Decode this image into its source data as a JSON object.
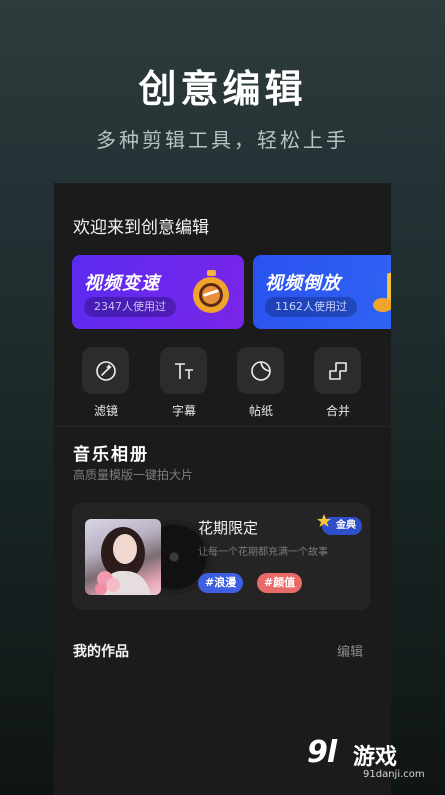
{
  "hero": {
    "title": "创意编辑",
    "subtitle": "多种剪辑工具，轻松上手"
  },
  "screen": {
    "welcome": "欢迎来到创意编辑",
    "feature_cards": [
      {
        "title": "视频变速",
        "count": "2347人使用过",
        "color": "#6a2aee",
        "icon": "stopwatch-icon"
      },
      {
        "title": "视频倒放",
        "count": "1162人使用过",
        "color": "#2c5af1",
        "icon": "music-note-icon"
      }
    ],
    "tools": [
      {
        "label": "滤镜",
        "icon": "magic-sparkle-icon"
      },
      {
        "label": "字幕",
        "icon": "text-size-icon"
      },
      {
        "label": "帖纸",
        "icon": "sticker-icon"
      },
      {
        "label": "合并",
        "icon": "merge-icon"
      }
    ],
    "album": {
      "title": "音乐相册",
      "subtitle": "高质量模版一键拍大片",
      "card": {
        "song": "花期限定",
        "badge": "金典",
        "description": "让每一个花期都充满一个故事",
        "tags": [
          "#浪漫",
          "#颜值"
        ]
      }
    },
    "works": {
      "label": "我的作品",
      "edit": "编辑"
    }
  },
  "watermark": {
    "logo": "9l",
    "name": "游戏",
    "url": "91danji.com"
  }
}
